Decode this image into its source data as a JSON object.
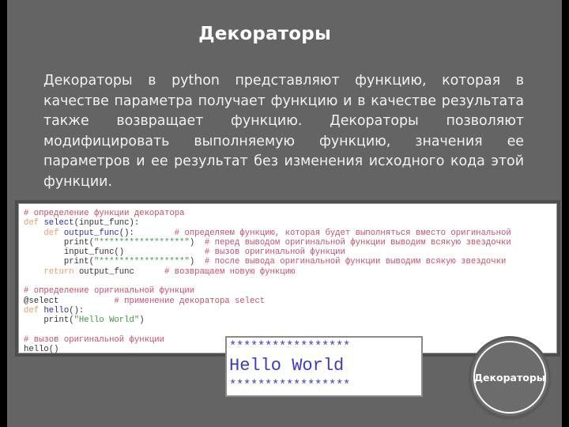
{
  "slide": {
    "title": "Декораторы",
    "description": "Декораторы в python представляют функцию, которая в качестве параметра получает функцию и в качестве результата также возвращает функцию. Декораторы позволяют модифицировать выполняемую функцию, значения ее параметров и ее результат без изменения исходного кода этой функции.",
    "badge_label": "Декораторы"
  },
  "code": {
    "lines": [
      [
        {
          "t": "# определение функции декоратора",
          "c": "comment"
        }
      ],
      [
        {
          "t": "def ",
          "c": "kw"
        },
        {
          "t": "select",
          "c": "name"
        },
        {
          "t": "(input_func):",
          "c": "plain"
        }
      ],
      [
        {
          "t": "    def ",
          "c": "kw"
        },
        {
          "t": "output_func",
          "c": "name"
        },
        {
          "t": "():        ",
          "c": "plain"
        },
        {
          "t": "# определяем функцию, которая будет выполняться вместо оригинальной",
          "c": "comment"
        }
      ],
      [
        {
          "t": "        print(",
          "c": "plain"
        },
        {
          "t": "\"*****************\"",
          "c": "str"
        },
        {
          "t": ")  ",
          "c": "plain"
        },
        {
          "t": "# перед выводом оригинальной функции выводим всякую звездочки",
          "c": "comment"
        }
      ],
      [
        {
          "t": "        input_func()                ",
          "c": "plain"
        },
        {
          "t": "# вызов оригинальной функции",
          "c": "comment"
        }
      ],
      [
        {
          "t": "        print(",
          "c": "plain"
        },
        {
          "t": "\"*****************\"",
          "c": "str"
        },
        {
          "t": ")  ",
          "c": "plain"
        },
        {
          "t": "# после вывода оригинальной функции выводим всякую звездочки",
          "c": "comment"
        }
      ],
      [
        {
          "t": "    return ",
          "c": "kw"
        },
        {
          "t": "output_func      ",
          "c": "plain"
        },
        {
          "t": "# возвращаем новую функцию",
          "c": "comment"
        }
      ],
      [
        {
          "t": "",
          "c": "plain"
        }
      ],
      [
        {
          "t": "# определение оригинальной функции",
          "c": "comment"
        }
      ],
      [
        {
          "t": "@select           ",
          "c": "plain"
        },
        {
          "t": "# применение декоратора select",
          "c": "comment"
        }
      ],
      [
        {
          "t": "def ",
          "c": "kw"
        },
        {
          "t": "hello",
          "c": "name"
        },
        {
          "t": "():",
          "c": "plain"
        }
      ],
      [
        {
          "t": "    print(",
          "c": "plain"
        },
        {
          "t": "\"Hello World\"",
          "c": "str"
        },
        {
          "t": ")",
          "c": "plain"
        }
      ],
      [
        {
          "t": "",
          "c": "plain"
        }
      ],
      [
        {
          "t": "# вызов оригинальной функции",
          "c": "comment"
        }
      ],
      [
        {
          "t": "hello()",
          "c": "plain"
        }
      ]
    ]
  },
  "output": {
    "stars_top": "*****************",
    "hello": "Hello World",
    "stars_bottom": "*****************"
  },
  "colors": {
    "background": "#646464",
    "comment": "#c8506a",
    "keyword": "#e8a070",
    "function_name": "#2b2bb0",
    "string": "#3a9a3a",
    "output_text": "#3b3bc4"
  }
}
